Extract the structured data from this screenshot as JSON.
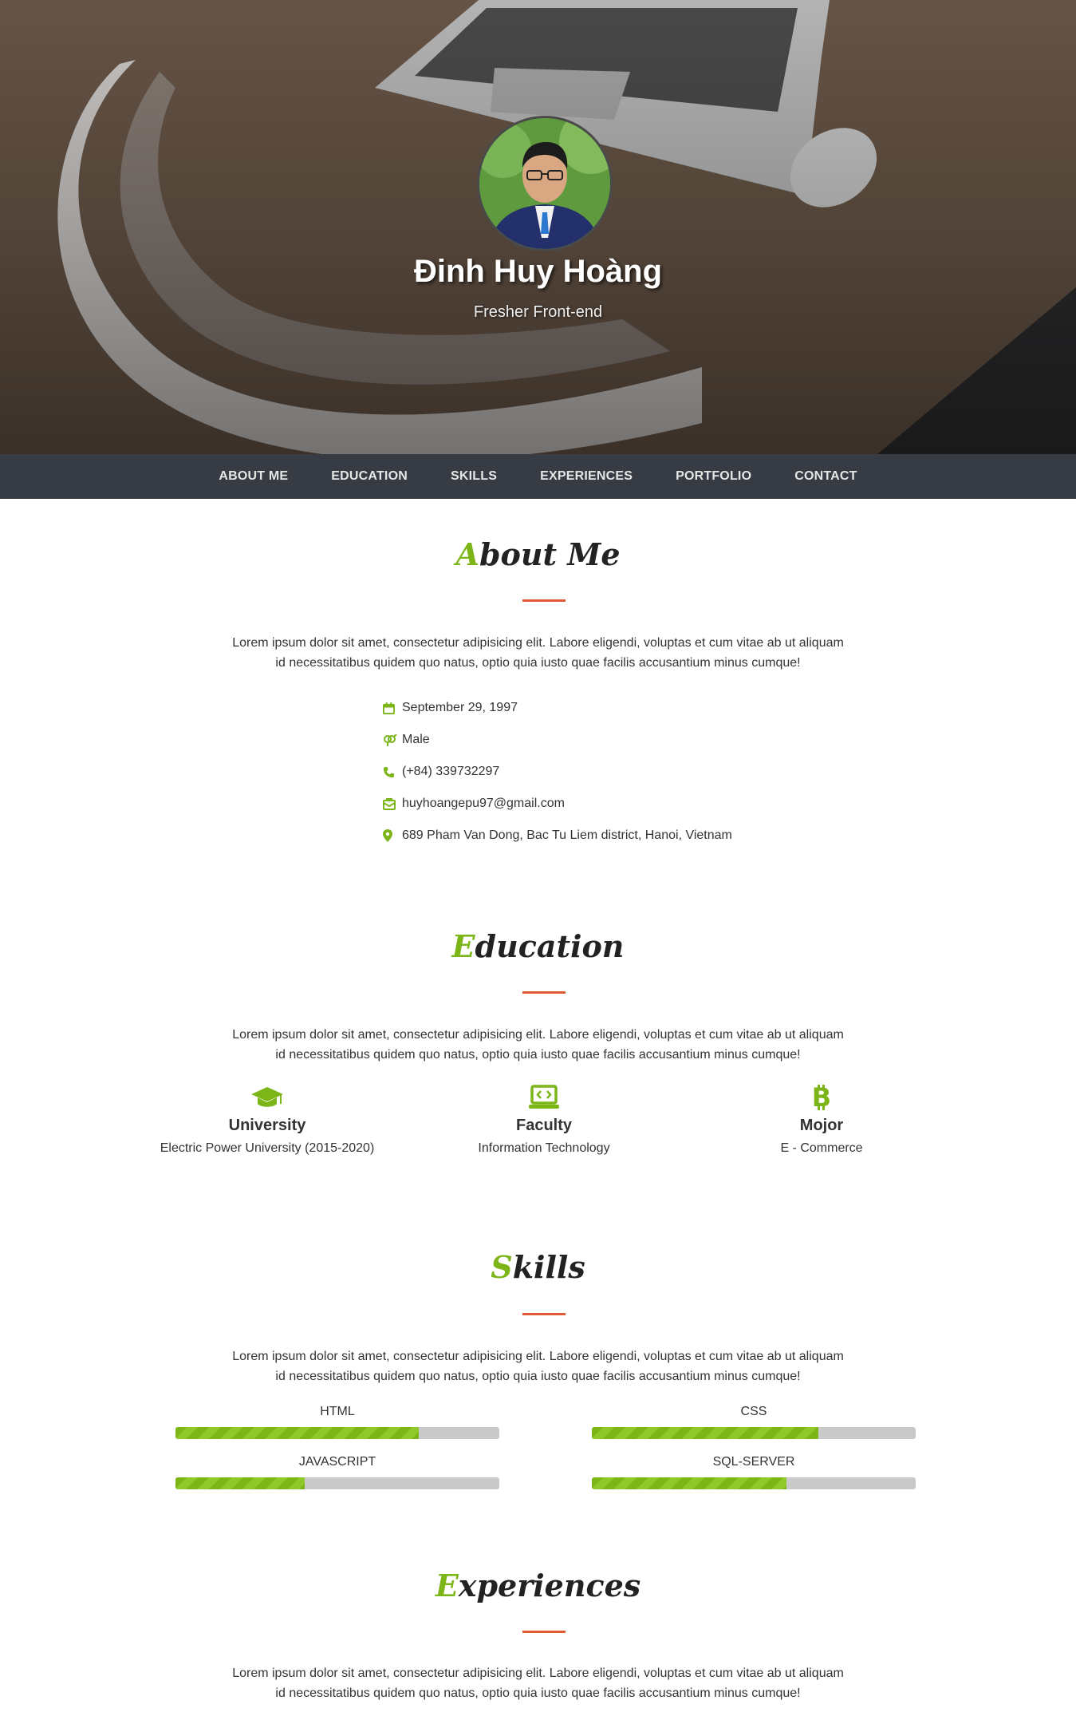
{
  "hero": {
    "name": "Đinh Huy Hoàng",
    "role": "Fresher Front-end"
  },
  "nav": {
    "items": [
      "ABOUT ME",
      "EDUCATION",
      "SKILLS",
      "EXPERIENCES",
      "PORTFOLIO",
      "CONTACT"
    ]
  },
  "about": {
    "title_first": "A",
    "title_rest": "bout Me",
    "text_line1": "Lorem ipsum dolor sit amet, consectetur adipisicing elit. Labore eligendi, voluptas et cum vitae ab ut aliquam",
    "text_line2": "id necessitatibus quidem quo natus, optio quia iusto quae facilis accusantium minus cumque!",
    "info": [
      {
        "icon": "calendar-icon",
        "text": "September 29, 1997"
      },
      {
        "icon": "gender-icon",
        "text": "Male"
      },
      {
        "icon": "phone-icon",
        "text": "(+84) 339732297"
      },
      {
        "icon": "envelope-icon",
        "text": "huyhoangepu97@gmail.com"
      },
      {
        "icon": "map-marker-icon",
        "text": "689 Pham Van Dong, Bac Tu Liem district, Hanoi, Vietnam"
      }
    ]
  },
  "education": {
    "title_first": "E",
    "title_rest": "ducation",
    "text_line1": "Lorem ipsum dolor sit amet, consectetur adipisicing elit. Labore eligendi, voluptas et cum vitae ab ut aliquam",
    "text_line2": "id necessitatibus quidem quo natus, optio quia iusto quae facilis accusantium minus cumque!",
    "items": [
      {
        "icon": "graduation-cap-icon",
        "heading": "University",
        "detail": "Electric Power University (2015-2020)"
      },
      {
        "icon": "laptop-code-icon",
        "heading": "Faculty",
        "detail": "Information Technology"
      },
      {
        "icon": "bitcoin-icon",
        "heading": "Mojor",
        "detail": "E - Commerce"
      }
    ]
  },
  "skills": {
    "title_first": "S",
    "title_rest": "kills",
    "text_line1": "Lorem ipsum dolor sit amet, consectetur adipisicing elit. Labore eligendi, voluptas et cum vitae ab ut aliquam",
    "text_line2": "id necessitatibus quidem quo natus, optio quia iusto quae facilis accusantium minus cumque!",
    "items": [
      {
        "name": "HTML",
        "level": 0.75
      },
      {
        "name": "CSS",
        "level": 0.7
      },
      {
        "name": "JAVASCRIPT",
        "level": 0.4
      },
      {
        "name": "SQL-SERVER",
        "level": 0.6
      }
    ]
  },
  "experiences": {
    "title_first": "E",
    "title_rest": "xperiences",
    "text_line1": "Lorem ipsum dolor sit amet, consectetur adipisicing elit. Labore eligendi, voluptas et cum vitae ab ut aliquam",
    "text_line2": "id necessitatibus quidem quo natus, optio quia iusto quae facilis accusantium minus cumque!"
  },
  "colors": {
    "accent": "#7cb518",
    "rule": "#e05a33",
    "nav_bg": "#373b43"
  }
}
